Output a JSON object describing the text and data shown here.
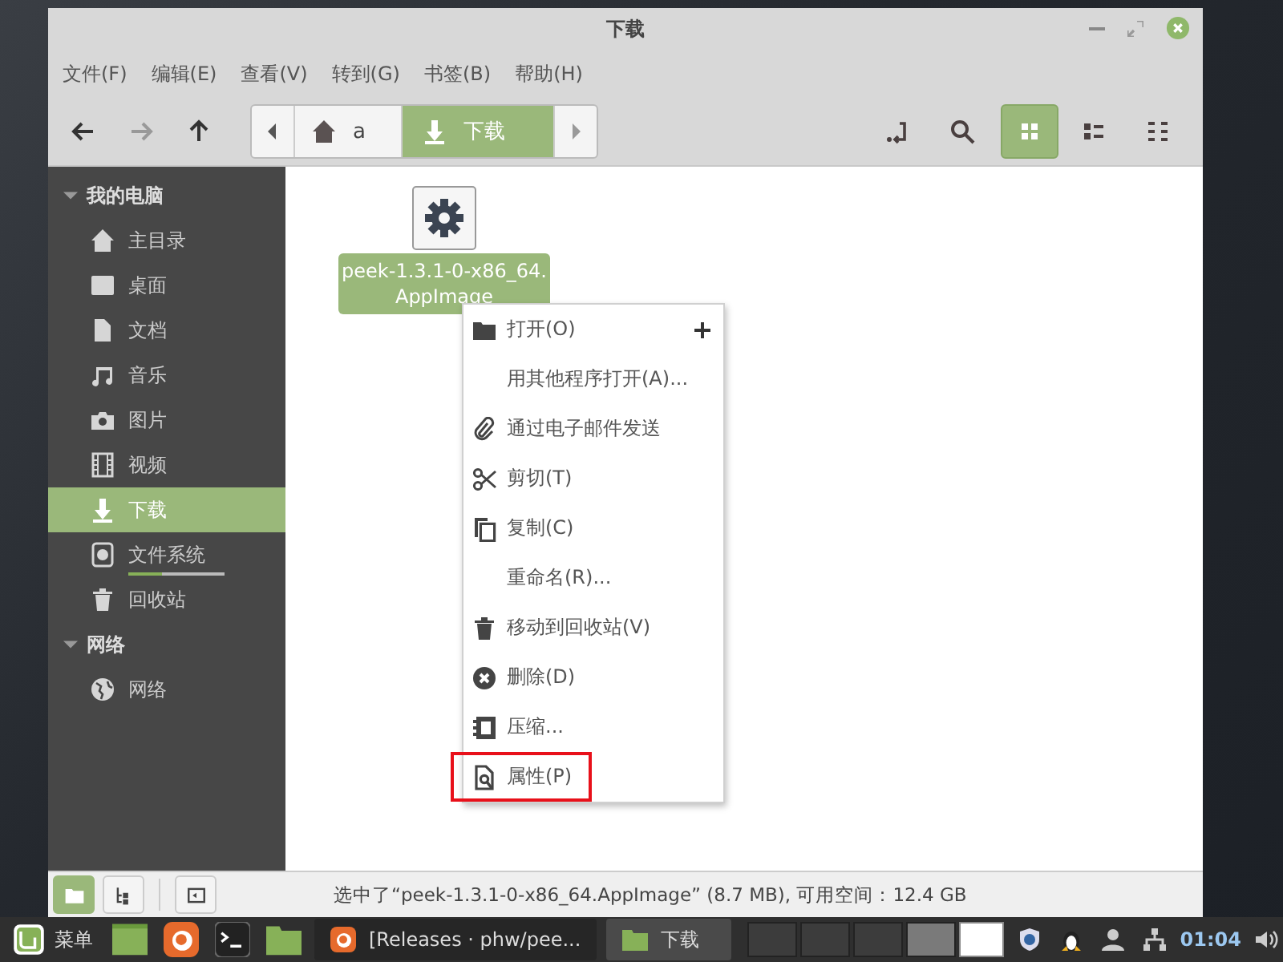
{
  "window": {
    "title": "下载"
  },
  "menu_bar": [
    "文件(F)",
    "编辑(E)",
    "查看(V)",
    "转到(G)",
    "书签(B)",
    "帮助(H)"
  ],
  "nav_buttons": [
    {
      "kind": "back",
      "disabled": false
    },
    {
      "kind": "forward",
      "disabled": true
    },
    {
      "kind": "up",
      "disabled": false
    }
  ],
  "path_bar": [
    {
      "label": "a",
      "kind": "home",
      "selected": false
    },
    {
      "label": "下载",
      "kind": "download",
      "selected": true
    }
  ],
  "view_modes": [
    {
      "kind": "icons",
      "selected": true
    },
    {
      "kind": "list",
      "selected": false
    },
    {
      "kind": "compact",
      "selected": false
    }
  ],
  "sidebar": [
    {
      "title": "我的电脑",
      "expanded": true,
      "items": [
        {
          "label": "主目录",
          "kind": "home",
          "selected": false
        },
        {
          "label": "桌面",
          "kind": "desktop",
          "selected": false
        },
        {
          "label": "文档",
          "kind": "document",
          "selected": false
        },
        {
          "label": "音乐",
          "kind": "music",
          "selected": false
        },
        {
          "label": "图片",
          "kind": "camera",
          "selected": false
        },
        {
          "label": "视频",
          "kind": "film",
          "selected": false
        },
        {
          "label": "下载",
          "kind": "download",
          "selected": true
        },
        {
          "label": "文件系统",
          "kind": "drive",
          "selected": false,
          "level": 0.35
        },
        {
          "label": "回收站",
          "kind": "trash",
          "selected": false
        }
      ]
    },
    {
      "title": "网络",
      "expanded": true,
      "items": [
        {
          "label": "网络",
          "kind": "globe",
          "selected": false
        }
      ]
    }
  ],
  "files": [
    {
      "name_lines": [
        "peek-1.3.1-0-x86_64.",
        "AppImage"
      ],
      "selected": true
    }
  ],
  "context_menu": [
    {
      "label": "打开(O)",
      "kind": "folder",
      "submenu": true,
      "highlighted": false
    },
    {
      "label": "用其他程序打开(A)...",
      "kind": "none",
      "submenu": false,
      "highlighted": false
    },
    {
      "label": "通过电子邮件发送",
      "kind": "clip",
      "submenu": false,
      "highlighted": false
    },
    {
      "label": "剪切(T)",
      "kind": "scissors",
      "submenu": false,
      "highlighted": false
    },
    {
      "label": "复制(C)",
      "kind": "copy",
      "submenu": false,
      "highlighted": false
    },
    {
      "label": "重命名(R)...",
      "kind": "none",
      "submenu": false,
      "highlighted": false
    },
    {
      "label": "移动到回收站(V)",
      "kind": "trash",
      "submenu": false,
      "highlighted": false
    },
    {
      "label": "删除(D)",
      "kind": "delete",
      "submenu": false,
      "highlighted": false
    },
    {
      "label": "压缩...",
      "kind": "archive",
      "submenu": false,
      "highlighted": false
    },
    {
      "label": "属性(P)",
      "kind": "properties",
      "submenu": false,
      "highlighted": true
    }
  ],
  "status_bar": {
    "pane_buttons": [
      {
        "kind": "places",
        "selected": true
      },
      {
        "kind": "tree",
        "selected": false
      }
    ],
    "text": "选中了“peek-1.3.1-0-x86_64.AppImage” (8.7 MB), 可用空间：12.4 GB"
  },
  "taskbar": {
    "menu_label": "菜单",
    "launchers": [
      {
        "kind": "desktop"
      },
      {
        "kind": "firefox"
      },
      {
        "kind": "terminal"
      },
      {
        "kind": "folder"
      }
    ],
    "windows": [
      {
        "label": "[Releases · phw/pee...",
        "kind": "firefox",
        "selected": false
      },
      {
        "label": "下载",
        "kind": "folder",
        "selected": true
      }
    ],
    "workspaces": [
      {
        "selected": false
      },
      {
        "selected": false
      },
      {
        "selected": false
      },
      {
        "selected": true
      }
    ],
    "tray": [
      {
        "kind": "shield"
      },
      {
        "kind": "penguin"
      },
      {
        "kind": "user"
      },
      {
        "kind": "network"
      }
    ],
    "clock": "01:04"
  }
}
